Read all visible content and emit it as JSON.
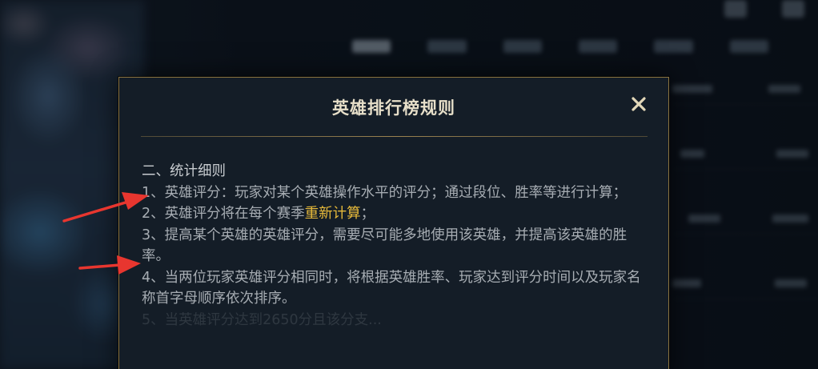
{
  "modal": {
    "title": "英雄排行榜规则",
    "close_icon": "close-icon",
    "section_heading": "二、统计细则",
    "rules": [
      {
        "text": "1、英雄评分：玩家对某个英雄操作水平的评分；通过段位、胜率等进行计算；"
      },
      {
        "pre": "2、英雄评分将在每个赛季",
        "highlight": "重新计算",
        "post": "；"
      },
      {
        "text": "3、提高某个英雄的英雄评分，需要尽可能多地使用该英雄，并提高该英雄的胜率。"
      },
      {
        "text": "4、当两位玩家英雄评分相同时，将根据英雄胜率、玩家达到评分时间以及玩家名称首字母顺序依次排序。"
      }
    ],
    "faded_line": "5、当英雄评分达到2650分且该分支..."
  },
  "colors": {
    "border_gold": "#8a7340",
    "highlight": "#e6b93a",
    "annotation_arrow": "#e8362f"
  },
  "annotations": [
    "red-arrow-rule-1",
    "red-arrow-rule-3"
  ]
}
